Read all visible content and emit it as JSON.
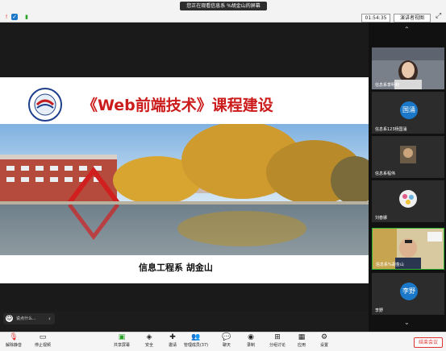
{
  "topbar": {
    "sharing_banner": "您正在观看信息系 %胡金山的屏幕",
    "timer": "01:54:35",
    "view_button": "演讲者视图",
    "window_icon": "fullscreen-icon"
  },
  "slide": {
    "title": "《Web前端技术》课程建设",
    "caption": "信息工程系    胡金山"
  },
  "reactions": {
    "label": "说点什么..."
  },
  "participants": [
    {
      "name": "信息系季明莉",
      "avatar": "",
      "avatar_color": ""
    },
    {
      "name": "信息系123杨国涌",
      "avatar": "国涌",
      "avatar_color": "#1b78c8"
    },
    {
      "name": "信息系程伟",
      "avatar": "",
      "avatar_color": ""
    },
    {
      "name": "刘春娜",
      "avatar": "",
      "avatar_color": ""
    },
    {
      "name": "信息系%胡金山",
      "avatar": "",
      "avatar_color": ""
    },
    {
      "name": "李野",
      "avatar": "李野",
      "avatar_color": "#1b78c8"
    }
  ],
  "toolbar": [
    {
      "label": "解除静音",
      "icon": "microphone-icon"
    },
    {
      "label": "停止视频",
      "icon": "camera-icon"
    },
    {
      "label": "共享屏幕",
      "icon": "screen-share-icon"
    },
    {
      "label": "安全",
      "icon": "shield-icon"
    },
    {
      "label": "邀请",
      "icon": "invite-icon"
    },
    {
      "label": "管理成员(37)",
      "icon": "members-icon"
    },
    {
      "label": "聊天",
      "icon": "chat-icon"
    },
    {
      "label": "录制",
      "icon": "record-icon"
    },
    {
      "label": "分组讨论",
      "icon": "breakout-icon"
    },
    {
      "label": "应用",
      "icon": "apps-icon"
    },
    {
      "label": "设置",
      "icon": "gear-icon"
    }
  ],
  "end_button": "结束会议"
}
